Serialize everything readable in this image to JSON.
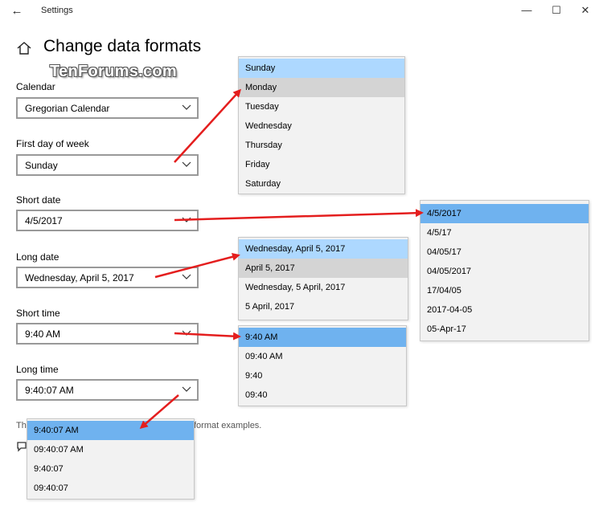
{
  "window": {
    "title": "Settings",
    "back_icon": "back-arrow-icon",
    "min_glyph": "—",
    "max_glyph": "☐",
    "close_glyph": "✕"
  },
  "page": {
    "title": "Change data formats",
    "watermark": "TenForums.com"
  },
  "fields": {
    "calendar": {
      "label": "Calendar",
      "value": "Gregorian Calendar"
    },
    "first_day": {
      "label": "First day of week",
      "value": "Sunday"
    },
    "short_date": {
      "label": "Short date",
      "value": "4/5/2017"
    },
    "long_date": {
      "label": "Long date",
      "value": "Wednesday, April 5, 2017"
    },
    "short_time": {
      "label": "Short time",
      "value": "9:40 AM"
    },
    "long_time": {
      "label": "Long time",
      "value": "9:40:07 AM"
    }
  },
  "partial_text": {
    "left": "Th",
    "right": "format examples."
  },
  "dropdowns": {
    "first_day": [
      "Sunday",
      "Monday",
      "Tuesday",
      "Wednesday",
      "Thursday",
      "Friday",
      "Saturday"
    ],
    "short_date": [
      "4/5/2017",
      "4/5/17",
      "04/05/17",
      "04/05/2017",
      "17/04/05",
      "2017-04-05",
      "05-Apr-17"
    ],
    "long_date": [
      "Wednesday, April 5, 2017",
      "April 5, 2017",
      "Wednesday, 5 April, 2017",
      "5 April, 2017"
    ],
    "short_time": [
      "9:40 AM",
      "09:40 AM",
      "9:40",
      "09:40"
    ],
    "long_time": [
      "9:40:07 AM",
      "09:40:07 AM",
      "9:40:07",
      "09:40:07"
    ]
  },
  "colors": {
    "selected_light": "#add8ff",
    "selected_strong": "#6fb2ef",
    "hover": "#d4d4d4",
    "arrow": "#e41e1e"
  }
}
